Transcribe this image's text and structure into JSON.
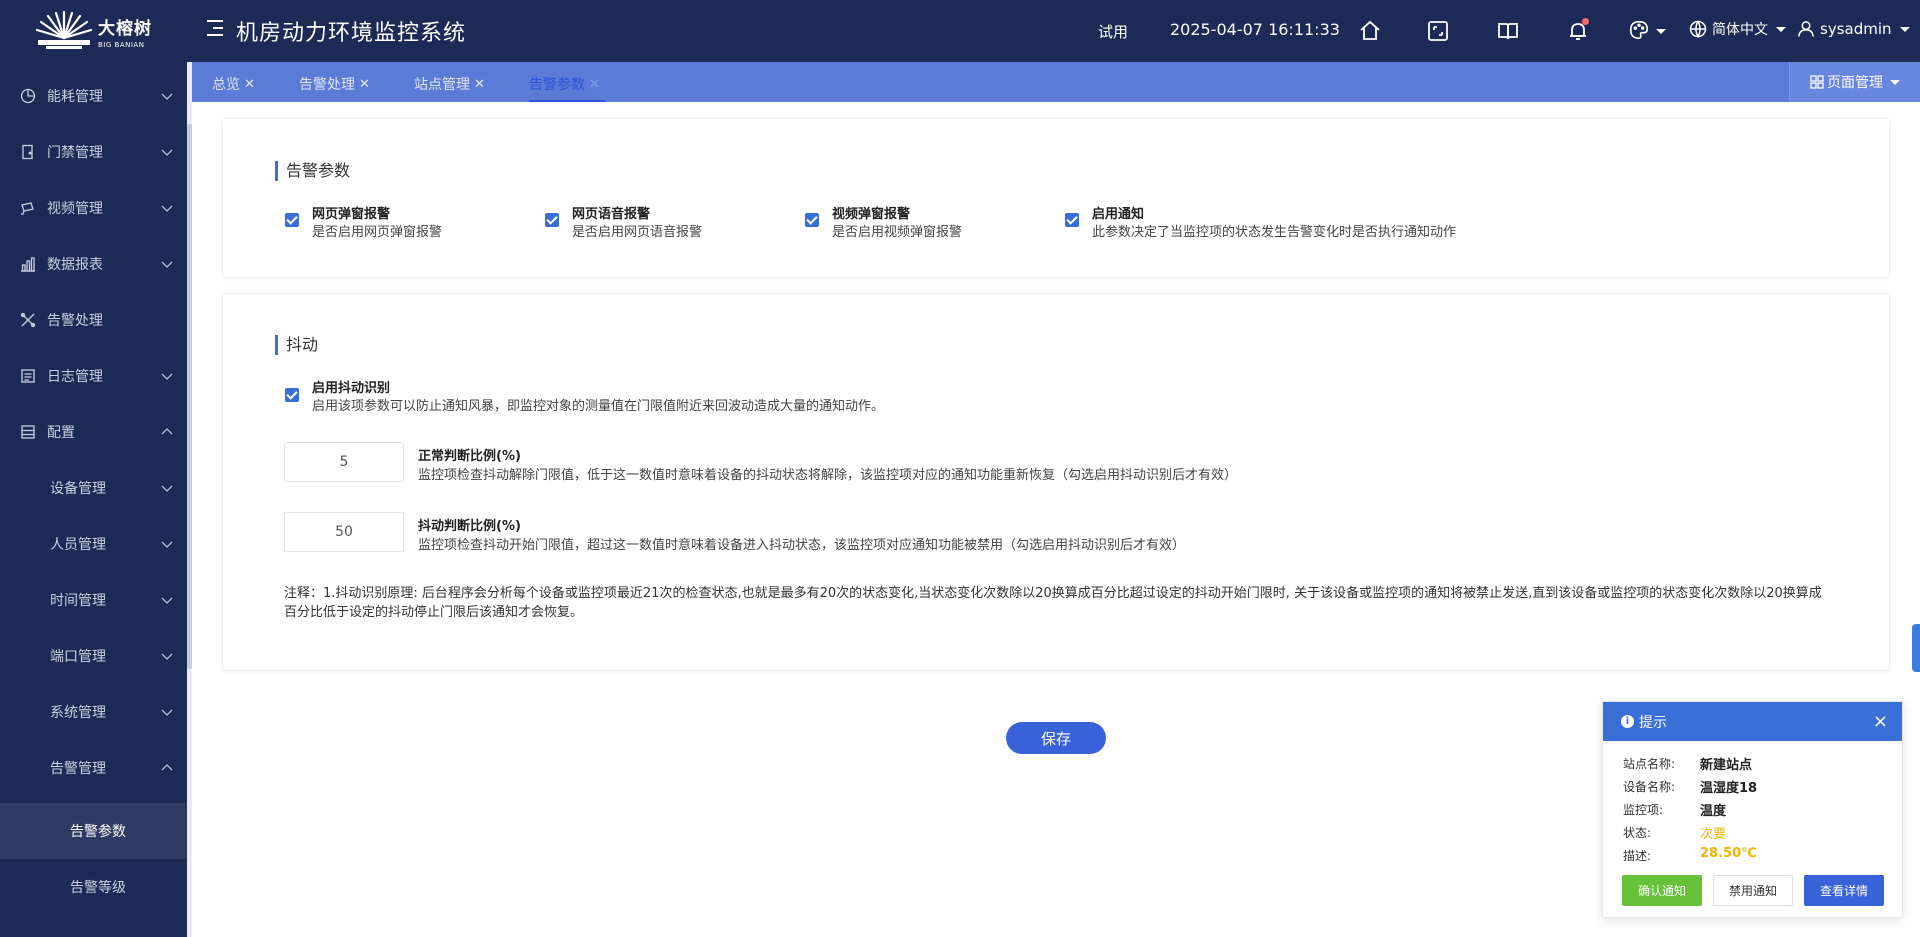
{
  "header": {
    "logo_cn": "大榕树",
    "logo_en": "BIG BANIAN",
    "title": "机房动力环境监控系统",
    "trial": "试用",
    "datetime": "2025-04-07 16:11:33",
    "language": "简体中文",
    "username": "sysadmin"
  },
  "sidebar": {
    "items": [
      {
        "label": "能耗管理"
      },
      {
        "label": "门禁管理"
      },
      {
        "label": "视频管理"
      },
      {
        "label": "数据报表"
      },
      {
        "label": "告警处理"
      },
      {
        "label": "日志管理"
      },
      {
        "label": "配置"
      }
    ],
    "sub_items": [
      {
        "label": "设备管理"
      },
      {
        "label": "人员管理"
      },
      {
        "label": "时间管理"
      },
      {
        "label": "端口管理"
      },
      {
        "label": "系统管理"
      },
      {
        "label": "告警管理"
      }
    ],
    "subsub_items": [
      {
        "label": "告警参数"
      },
      {
        "label": "告警等级"
      }
    ]
  },
  "tabs": [
    {
      "label": "总览"
    },
    {
      "label": "告警处理"
    },
    {
      "label": "站点管理"
    },
    {
      "label": "告警参数"
    }
  ],
  "page_manage": "页面管理",
  "alarm_section": {
    "title": "告警参数",
    "options": [
      {
        "title": "网页弹窗报警",
        "desc": "是否启用网页弹窗报警"
      },
      {
        "title": "网页语音报警",
        "desc": "是否启用网页语音报警"
      },
      {
        "title": "视频弹窗报警",
        "desc": "是否启用视频弹窗报警"
      },
      {
        "title": "启用通知",
        "desc": "此参数决定了当监控项的状态发生告警变化时是否执行通知动作"
      }
    ]
  },
  "jitter_section": {
    "title": "抖动",
    "enable_title": "启用抖动识别",
    "enable_desc": "启用该项参数可以防止通知风暴，即监控对象的测量值在门限值附近来回波动造成大量的通知动作。",
    "normal_value": "5",
    "normal_title": "正常判断比例(%)",
    "normal_desc": "监控项检查抖动解除门限值，低于这一数值时意味着设备的抖动状态将解除，该监控项对应的通知功能重新恢复（勾选启用抖动识别后才有效）",
    "jitter_value": "50",
    "jitter_title": "抖动判断比例(%)",
    "jitter_desc": "监控项检查抖动开始门限值，超过这一数值时意味着设备进入抖动状态，该监控项对应通知功能被禁用（勾选启用抖动识别后才有效）",
    "note": "注释：1.抖动识别原理: 后台程序会分析每个设备或监控项最近21次的检查状态,也就是最多有20次的状态变化,当状态变化次数除以20换算成百分比超过设定的抖动开始门限时, 关于该设备或监控项的通知将被禁止发送,直到该设备或监控项的状态变化次数除以20换算成百分比低于设定的抖动停止门限后该通知才会恢复。"
  },
  "save_label": "保存",
  "popup": {
    "title": "提示",
    "rows": [
      {
        "label": "站点名称:",
        "value": "新建站点"
      },
      {
        "label": "设备名称:",
        "value": "温湿度18"
      },
      {
        "label": "监控项:",
        "value": "温度"
      },
      {
        "label": "状态:",
        "value": "次要"
      },
      {
        "label": "描述:",
        "value": "28.50℃"
      }
    ],
    "btn_confirm": "确认通知",
    "btn_disable": "禁用通知",
    "btn_detail": "查看详情",
    "colors": {
      "header": "#3a6fd8",
      "confirm": "#67c23a",
      "detail": "#3a62d8",
      "warn": "#f0b400"
    }
  }
}
